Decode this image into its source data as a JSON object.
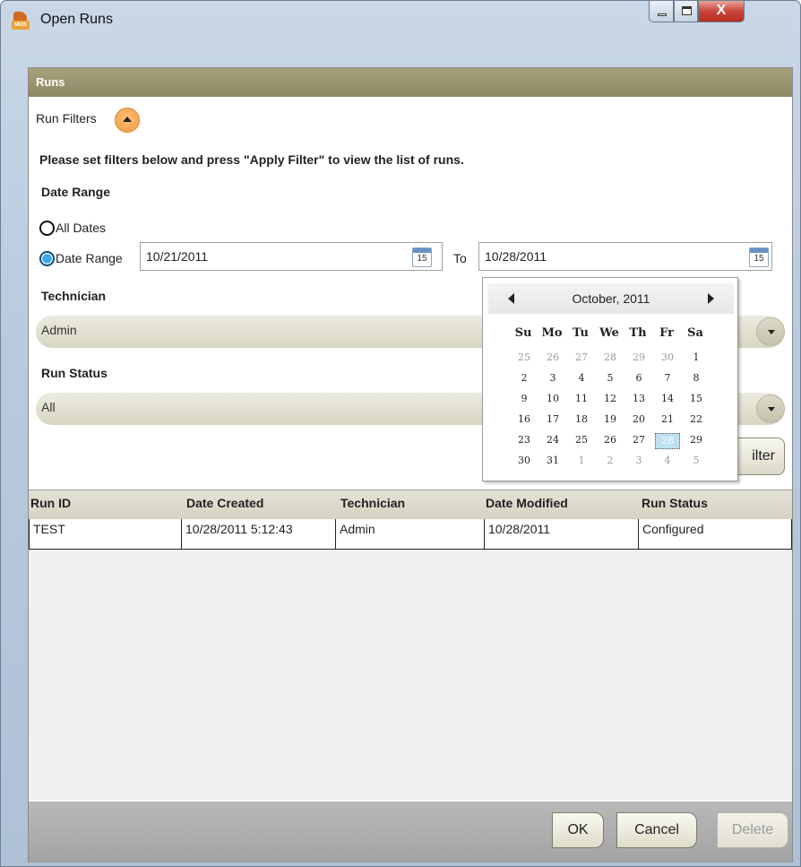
{
  "window": {
    "title": "Open Runs",
    "icon_text": "MOS",
    "close_glyph": "X"
  },
  "panel": {
    "header": "Runs",
    "filters_label": "Run Filters"
  },
  "filters": {
    "instructions": "Please set filters below and press \"Apply Filter\" to view the list of runs.",
    "date_range_label": "Date Range",
    "all_dates_label": "All Dates",
    "date_range_option_label": "Date Range",
    "selected_option": "Date Range",
    "from_date": "10/21/2011",
    "to_label": "To",
    "to_date": "10/28/2011",
    "calendar_icon_day": "15",
    "technician_label": "Technician",
    "technician_value": "Admin",
    "run_status_label": "Run Status",
    "run_status_value": "All",
    "apply_button": "ilter"
  },
  "calendar": {
    "month_title": "October, 2011",
    "dow": [
      "Su",
      "Mo",
      "Tu",
      "We",
      "Th",
      "Fr",
      "Sa"
    ],
    "weeks": [
      [
        "25",
        "26",
        "27",
        "28",
        "29",
        "30",
        "1"
      ],
      [
        "2",
        "3",
        "4",
        "5",
        "6",
        "7",
        "8"
      ],
      [
        "9",
        "10",
        "11",
        "12",
        "13",
        "14",
        "15"
      ],
      [
        "16",
        "17",
        "18",
        "19",
        "20",
        "21",
        "22"
      ],
      [
        "23",
        "24",
        "25",
        "26",
        "27",
        "28",
        "29"
      ],
      [
        "30",
        "31",
        "1",
        "2",
        "3",
        "4",
        "5"
      ]
    ],
    "selected": "28"
  },
  "grid": {
    "columns": [
      "Run ID",
      "Date Created",
      "Technician",
      "Date Modified",
      "Run Status"
    ],
    "rows": [
      [
        "TEST",
        "10/28/2011 5:12:43",
        "Admin",
        "10/28/2011",
        "Configured"
      ]
    ]
  },
  "footer": {
    "ok": "OK",
    "cancel": "Cancel",
    "delete": "Delete"
  }
}
